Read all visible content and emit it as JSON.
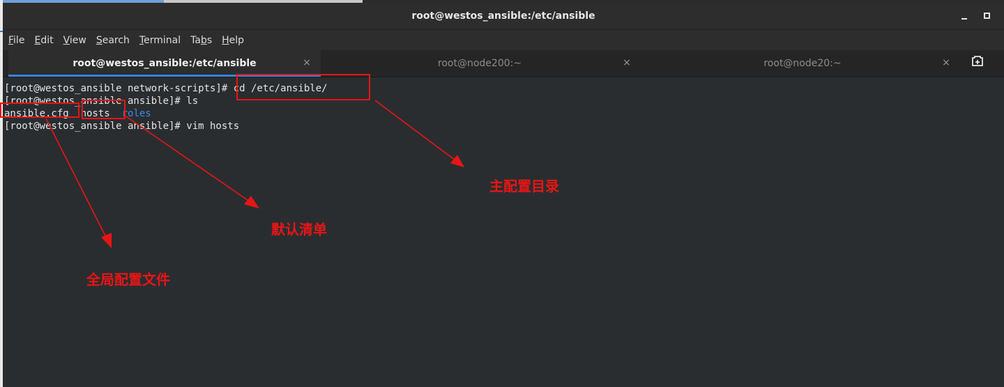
{
  "window": {
    "title": "root@westos_ansible:/etc/ansible"
  },
  "menu": [
    {
      "mnemonic": "F",
      "rest": "ile"
    },
    {
      "mnemonic": "E",
      "rest": "dit"
    },
    {
      "mnemonic": "V",
      "rest": "iew"
    },
    {
      "mnemonic": "S",
      "rest": "earch"
    },
    {
      "mnemonic": "T",
      "rest": "erminal"
    },
    {
      "pre": "Ta",
      "mnemonic": "b",
      "rest": "s"
    },
    {
      "mnemonic": "H",
      "rest": "elp"
    }
  ],
  "tabs": [
    {
      "label": "root@westos_ansible:/etc/ansible",
      "active": true
    },
    {
      "label": "root@node200:~",
      "active": false
    },
    {
      "label": "root@node20:~",
      "active": false
    }
  ],
  "close_glyph": "×",
  "terminal": {
    "line1": "[root@westos_ansible network-scripts]# cd /etc/ansible/",
    "line2": "[root@westos_ansible ansible]# ls",
    "line3_file1": "ansible.cfg",
    "line3_file2": "hosts",
    "line3_dir": "roles",
    "line4": "[root@westos_ansible ansible]# vim hosts"
  },
  "annotations": {
    "main_dir": "主配置目录",
    "default_inventory": "默认清单",
    "global_config": "全局配置文件",
    "color": "#e81515"
  }
}
